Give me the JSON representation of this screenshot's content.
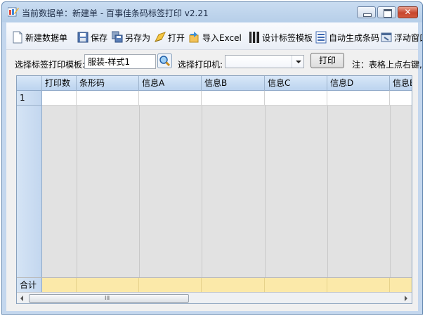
{
  "window": {
    "title": "当前数据单：新建单 - 百事佳条码标签打印 v2.21",
    "close_glyph": "✕"
  },
  "toolbar": {
    "items": [
      {
        "label": "新建数据单",
        "icon": "new-doc-icon"
      },
      {
        "label": "保存",
        "icon": "save-icon"
      },
      {
        "label": "另存为",
        "icon": "save-as-icon"
      },
      {
        "label": "打开",
        "icon": "open-icon"
      },
      {
        "label": "导入Excel",
        "icon": "import-excel-icon"
      },
      {
        "label": "设计标签模板",
        "icon": "barcode-icon"
      },
      {
        "label": "自动生成条码",
        "icon": "list-icon"
      },
      {
        "label": "浮动窗口",
        "icon": "float-window-icon"
      }
    ]
  },
  "template_row": {
    "template_label": "选择标签打印模板:",
    "template_value": "服装-样式1",
    "printer_label": "选择打印机:",
    "printer_value": "",
    "print_button": "打印",
    "note": "注：表格上点右键,"
  },
  "grid": {
    "columns": [
      "打印数",
      "条形码",
      "信息A",
      "信息B",
      "信息C",
      "信息D",
      "信息E"
    ],
    "rows": [
      {
        "number": "1",
        "cells": [
          "",
          "",
          "",
          "",
          "",
          "",
          ""
        ]
      }
    ],
    "total_label": "合计",
    "scroll_grip": "III"
  },
  "colors": {
    "title_bar": "#c9dcf1",
    "header": "#bcd4ef",
    "total_row": "#fbe9a9",
    "grid_empty": "#e2e2e2"
  }
}
